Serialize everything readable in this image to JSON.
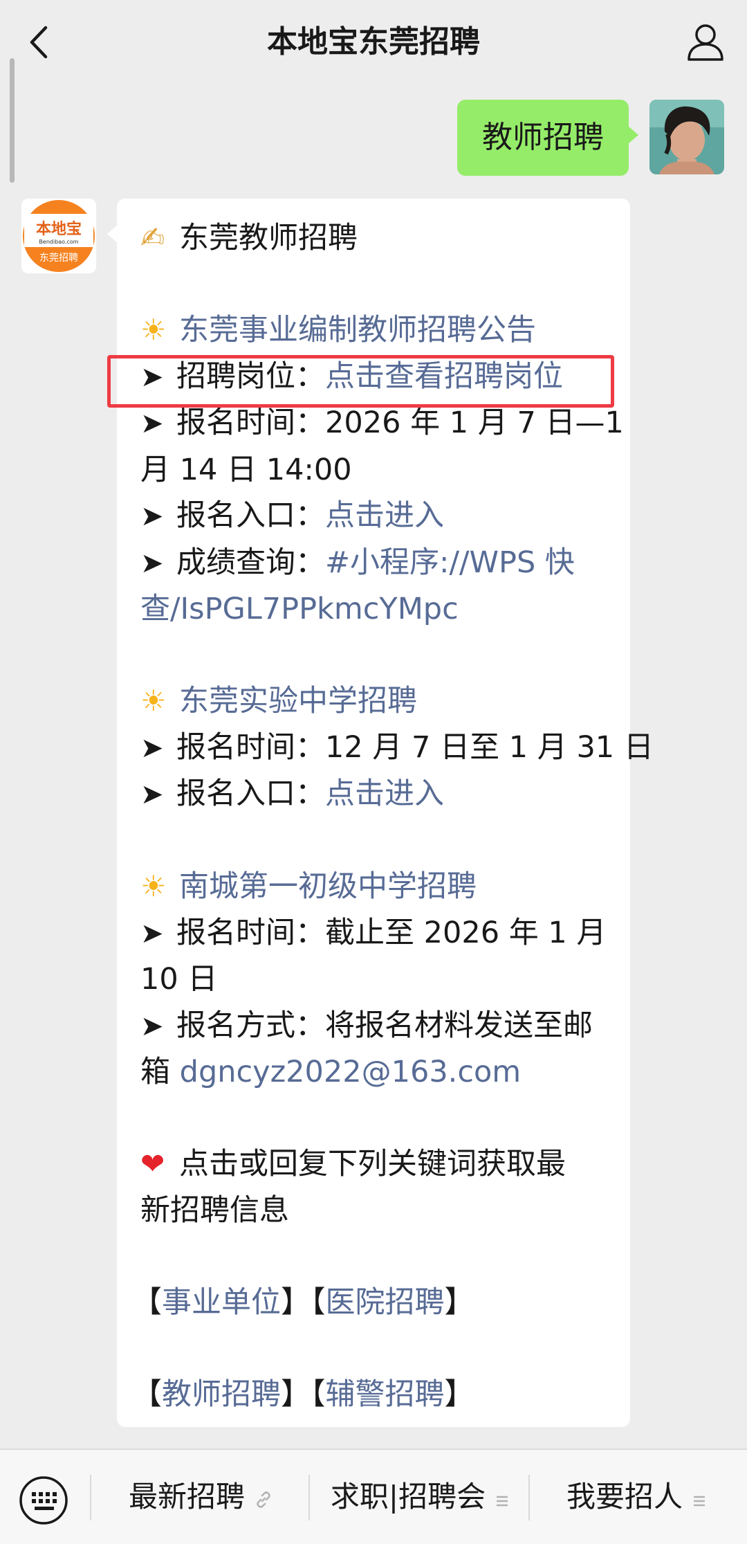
{
  "header": {
    "title": "本地宝东莞招聘",
    "back_icon": "chevron-left-icon",
    "profile_icon": "person-icon"
  },
  "outgoing": {
    "text": "教师招聘"
  },
  "bot": {
    "logo_text": "本地宝",
    "logo_sub": "Bendibao.com",
    "logo_tag": "东莞招聘",
    "brand_color": "#f5821f"
  },
  "message": {
    "title_emoji": "✍",
    "title": "东莞教师招聘",
    "arrow": "➤",
    "sun": "☀",
    "heart": "❤",
    "section1": {
      "title": "东莞事业编制教师招聘公告",
      "post_label": "招聘岗位：",
      "post_link": "点击查看招聘岗位",
      "time_line1": "报名时间：2026 年 1 月 7 日—1",
      "time_line2": "月 14 日 14:00",
      "entry_label": "报名入口：",
      "entry_link": "点击进入",
      "score_label": "成绩查询：",
      "score_link1": "#小程序://WPS 快",
      "score_link2": "查/IsPGL7PPkmcYMpc"
    },
    "section2": {
      "title": "东莞实验中学招聘",
      "time": "报名时间：12 月 7 日至 1 月 31 日",
      "entry_label": "报名入口：",
      "entry_link": "点击进入"
    },
    "section3": {
      "title": "南城第一初级中学招聘",
      "time_line1": "报名时间：截止至 2026 年 1 月",
      "time_line2": "10 日",
      "method_line1": "报名方式：将报名材料发送至邮",
      "method_line2_prefix": "箱 ",
      "email": "dgncyz2022@163.com"
    },
    "footer": {
      "line1": "点击或回复下列关键词获取最",
      "line2": "新招聘信息",
      "bracket_open": "【",
      "bracket_close": "】",
      "kw1": "事业单位",
      "kw2": "医院招聘",
      "kw3": "教师招聘",
      "kw4": "辅警招聘"
    }
  },
  "bottom_menu": {
    "keyboard_icon": "keyboard-icon",
    "items": [
      {
        "label": "最新招聘",
        "icon": "link-icon"
      },
      {
        "label": "求职|招聘会",
        "icon": "menu-lines-icon"
      },
      {
        "label": "我要招人",
        "icon": "menu-lines-icon"
      }
    ]
  }
}
